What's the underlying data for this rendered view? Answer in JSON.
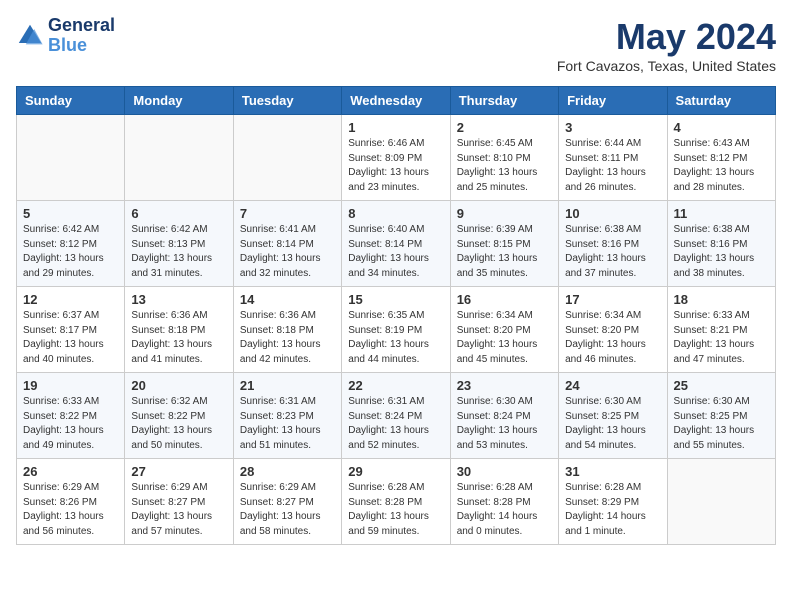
{
  "logo": {
    "line1": "General",
    "line2": "Blue"
  },
  "title": "May 2024",
  "location": "Fort Cavazos, Texas, United States",
  "days_of_week": [
    "Sunday",
    "Monday",
    "Tuesday",
    "Wednesday",
    "Thursday",
    "Friday",
    "Saturday"
  ],
  "weeks": [
    [
      {
        "day": "",
        "info": ""
      },
      {
        "day": "",
        "info": ""
      },
      {
        "day": "",
        "info": ""
      },
      {
        "day": "1",
        "info": "Sunrise: 6:46 AM\nSunset: 8:09 PM\nDaylight: 13 hours\nand 23 minutes."
      },
      {
        "day": "2",
        "info": "Sunrise: 6:45 AM\nSunset: 8:10 PM\nDaylight: 13 hours\nand 25 minutes."
      },
      {
        "day": "3",
        "info": "Sunrise: 6:44 AM\nSunset: 8:11 PM\nDaylight: 13 hours\nand 26 minutes."
      },
      {
        "day": "4",
        "info": "Sunrise: 6:43 AM\nSunset: 8:12 PM\nDaylight: 13 hours\nand 28 minutes."
      }
    ],
    [
      {
        "day": "5",
        "info": "Sunrise: 6:42 AM\nSunset: 8:12 PM\nDaylight: 13 hours\nand 29 minutes."
      },
      {
        "day": "6",
        "info": "Sunrise: 6:42 AM\nSunset: 8:13 PM\nDaylight: 13 hours\nand 31 minutes."
      },
      {
        "day": "7",
        "info": "Sunrise: 6:41 AM\nSunset: 8:14 PM\nDaylight: 13 hours\nand 32 minutes."
      },
      {
        "day": "8",
        "info": "Sunrise: 6:40 AM\nSunset: 8:14 PM\nDaylight: 13 hours\nand 34 minutes."
      },
      {
        "day": "9",
        "info": "Sunrise: 6:39 AM\nSunset: 8:15 PM\nDaylight: 13 hours\nand 35 minutes."
      },
      {
        "day": "10",
        "info": "Sunrise: 6:38 AM\nSunset: 8:16 PM\nDaylight: 13 hours\nand 37 minutes."
      },
      {
        "day": "11",
        "info": "Sunrise: 6:38 AM\nSunset: 8:16 PM\nDaylight: 13 hours\nand 38 minutes."
      }
    ],
    [
      {
        "day": "12",
        "info": "Sunrise: 6:37 AM\nSunset: 8:17 PM\nDaylight: 13 hours\nand 40 minutes."
      },
      {
        "day": "13",
        "info": "Sunrise: 6:36 AM\nSunset: 8:18 PM\nDaylight: 13 hours\nand 41 minutes."
      },
      {
        "day": "14",
        "info": "Sunrise: 6:36 AM\nSunset: 8:18 PM\nDaylight: 13 hours\nand 42 minutes."
      },
      {
        "day": "15",
        "info": "Sunrise: 6:35 AM\nSunset: 8:19 PM\nDaylight: 13 hours\nand 44 minutes."
      },
      {
        "day": "16",
        "info": "Sunrise: 6:34 AM\nSunset: 8:20 PM\nDaylight: 13 hours\nand 45 minutes."
      },
      {
        "day": "17",
        "info": "Sunrise: 6:34 AM\nSunset: 8:20 PM\nDaylight: 13 hours\nand 46 minutes."
      },
      {
        "day": "18",
        "info": "Sunrise: 6:33 AM\nSunset: 8:21 PM\nDaylight: 13 hours\nand 47 minutes."
      }
    ],
    [
      {
        "day": "19",
        "info": "Sunrise: 6:33 AM\nSunset: 8:22 PM\nDaylight: 13 hours\nand 49 minutes."
      },
      {
        "day": "20",
        "info": "Sunrise: 6:32 AM\nSunset: 8:22 PM\nDaylight: 13 hours\nand 50 minutes."
      },
      {
        "day": "21",
        "info": "Sunrise: 6:31 AM\nSunset: 8:23 PM\nDaylight: 13 hours\nand 51 minutes."
      },
      {
        "day": "22",
        "info": "Sunrise: 6:31 AM\nSunset: 8:24 PM\nDaylight: 13 hours\nand 52 minutes."
      },
      {
        "day": "23",
        "info": "Sunrise: 6:30 AM\nSunset: 8:24 PM\nDaylight: 13 hours\nand 53 minutes."
      },
      {
        "day": "24",
        "info": "Sunrise: 6:30 AM\nSunset: 8:25 PM\nDaylight: 13 hours\nand 54 minutes."
      },
      {
        "day": "25",
        "info": "Sunrise: 6:30 AM\nSunset: 8:25 PM\nDaylight: 13 hours\nand 55 minutes."
      }
    ],
    [
      {
        "day": "26",
        "info": "Sunrise: 6:29 AM\nSunset: 8:26 PM\nDaylight: 13 hours\nand 56 minutes."
      },
      {
        "day": "27",
        "info": "Sunrise: 6:29 AM\nSunset: 8:27 PM\nDaylight: 13 hours\nand 57 minutes."
      },
      {
        "day": "28",
        "info": "Sunrise: 6:29 AM\nSunset: 8:27 PM\nDaylight: 13 hours\nand 58 minutes."
      },
      {
        "day": "29",
        "info": "Sunrise: 6:28 AM\nSunset: 8:28 PM\nDaylight: 13 hours\nand 59 minutes."
      },
      {
        "day": "30",
        "info": "Sunrise: 6:28 AM\nSunset: 8:28 PM\nDaylight: 14 hours\nand 0 minutes."
      },
      {
        "day": "31",
        "info": "Sunrise: 6:28 AM\nSunset: 8:29 PM\nDaylight: 14 hours\nand 1 minute."
      },
      {
        "day": "",
        "info": ""
      }
    ]
  ]
}
